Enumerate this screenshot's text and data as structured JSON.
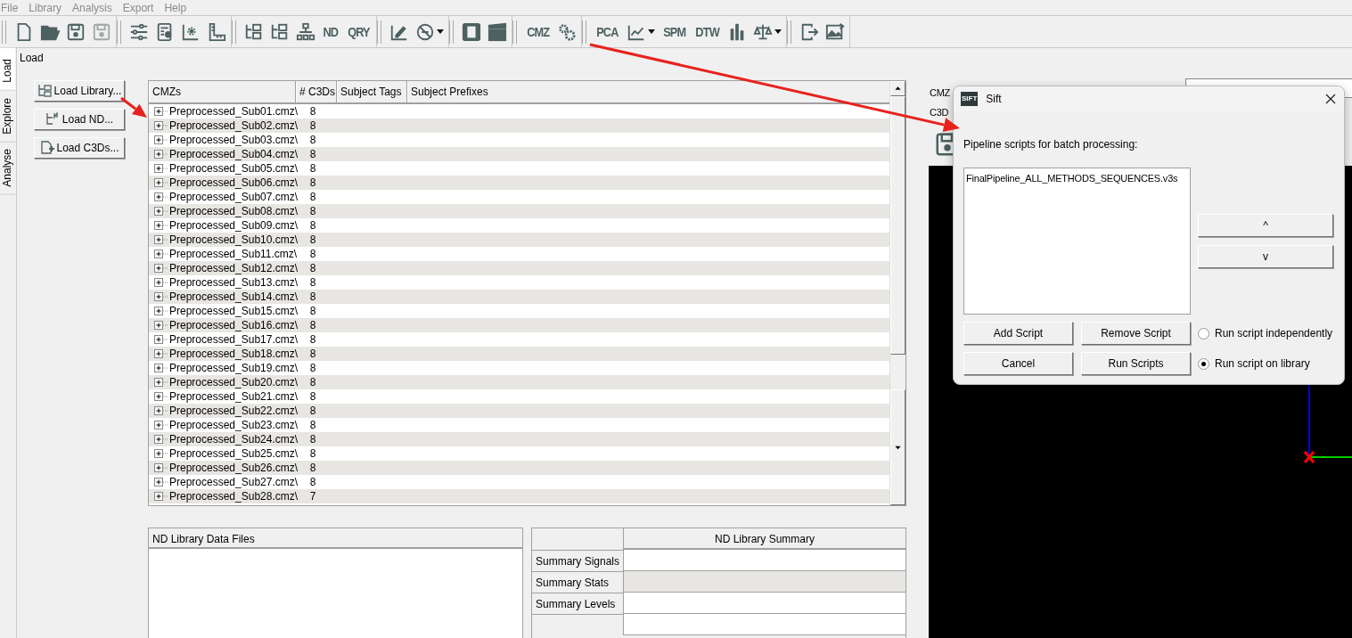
{
  "menu": [
    "File",
    "Library",
    "Analysis",
    "Export",
    "Help"
  ],
  "toolbar": {
    "groups": [
      {
        "items": [
          {
            "kind": "icon",
            "disabled": false
          },
          {
            "kind": "icon",
            "disabled": false
          },
          {
            "kind": "icon",
            "disabled": false
          },
          {
            "kind": "icon",
            "disabled": true
          }
        ]
      },
      {
        "items": [
          {
            "kind": "icon",
            "disabled": false
          },
          {
            "kind": "icon",
            "disabled": false
          },
          {
            "kind": "icon",
            "disabled": false
          },
          {
            "kind": "icon",
            "disabled": false
          }
        ]
      },
      {
        "items": [
          {
            "kind": "icon",
            "disabled": false
          },
          {
            "kind": "icon",
            "disabled": false
          },
          {
            "kind": "icon",
            "disabled": false
          },
          {
            "kind": "text",
            "label": "ND",
            "disabled": false
          },
          {
            "kind": "text",
            "label": "QRY",
            "disabled": false
          }
        ]
      },
      {
        "items": [
          {
            "kind": "icon",
            "disabled": false
          },
          {
            "kind": "icon",
            "disabled": false,
            "dropdown": true
          }
        ]
      },
      {
        "items": [
          {
            "kind": "icon",
            "disabled": false
          },
          {
            "kind": "icon",
            "disabled": false
          }
        ]
      },
      {
        "items": [
          {
            "kind": "text",
            "label": "CMZ",
            "disabled": false
          },
          {
            "kind": "icon",
            "disabled": false
          }
        ]
      },
      {
        "items": [
          {
            "kind": "text",
            "label": "PCA",
            "disabled": false
          },
          {
            "kind": "icon",
            "disabled": false,
            "dropdown": true
          },
          {
            "kind": "text",
            "label": "SPM",
            "disabled": false
          },
          {
            "kind": "text",
            "label": "DTW",
            "disabled": false
          },
          {
            "kind": "icon",
            "disabled": false
          },
          {
            "kind": "icon",
            "disabled": false,
            "dropdown": true
          }
        ]
      },
      {
        "items": [
          {
            "kind": "icon",
            "disabled": false
          },
          {
            "kind": "icon",
            "disabled": false
          }
        ]
      }
    ]
  },
  "side_tabs": [
    {
      "label": "Load",
      "selected": true
    },
    {
      "label": "Explore",
      "selected": false
    },
    {
      "label": "Analyse",
      "selected": false
    }
  ],
  "page_title": "Load",
  "load_buttons": [
    "Load Library...",
    "Load ND...",
    "Load C3Ds..."
  ],
  "cmz_table": {
    "columns": [
      "CMZs",
      "# C3Ds",
      "Subject Tags",
      "Subject Prefixes"
    ],
    "rows": [
      {
        "name": "Preprocessed_Sub01.cmz\\",
        "c3ds": "8"
      },
      {
        "name": "Preprocessed_Sub02.cmz\\",
        "c3ds": "8"
      },
      {
        "name": "Preprocessed_Sub03.cmz\\",
        "c3ds": "8"
      },
      {
        "name": "Preprocessed_Sub04.cmz\\",
        "c3ds": "8"
      },
      {
        "name": "Preprocessed_Sub05.cmz\\",
        "c3ds": "8"
      },
      {
        "name": "Preprocessed_Sub06.cmz\\",
        "c3ds": "8"
      },
      {
        "name": "Preprocessed_Sub07.cmz\\",
        "c3ds": "8"
      },
      {
        "name": "Preprocessed_Sub08.cmz\\",
        "c3ds": "8"
      },
      {
        "name": "Preprocessed_Sub09.cmz\\",
        "c3ds": "8"
      },
      {
        "name": "Preprocessed_Sub10.cmz\\",
        "c3ds": "8"
      },
      {
        "name": "Preprocessed_Sub11.cmz\\",
        "c3ds": "8"
      },
      {
        "name": "Preprocessed_Sub12.cmz\\",
        "c3ds": "8"
      },
      {
        "name": "Preprocessed_Sub13.cmz\\",
        "c3ds": "8"
      },
      {
        "name": "Preprocessed_Sub14.cmz\\",
        "c3ds": "8"
      },
      {
        "name": "Preprocessed_Sub15.cmz\\",
        "c3ds": "8"
      },
      {
        "name": "Preprocessed_Sub16.cmz\\",
        "c3ds": "8"
      },
      {
        "name": "Preprocessed_Sub17.cmz\\",
        "c3ds": "8"
      },
      {
        "name": "Preprocessed_Sub18.cmz\\",
        "c3ds": "8"
      },
      {
        "name": "Preprocessed_Sub19.cmz\\",
        "c3ds": "8"
      },
      {
        "name": "Preprocessed_Sub20.cmz\\",
        "c3ds": "8"
      },
      {
        "name": "Preprocessed_Sub21.cmz\\",
        "c3ds": "8"
      },
      {
        "name": "Preprocessed_Sub22.cmz\\",
        "c3ds": "8"
      },
      {
        "name": "Preprocessed_Sub23.cmz\\",
        "c3ds": "8"
      },
      {
        "name": "Preprocessed_Sub24.cmz\\",
        "c3ds": "8"
      },
      {
        "name": "Preprocessed_Sub25.cmz\\",
        "c3ds": "8"
      },
      {
        "name": "Preprocessed_Sub26.cmz\\",
        "c3ds": "8"
      },
      {
        "name": "Preprocessed_Sub27.cmz\\",
        "c3ds": "8"
      },
      {
        "name": "Preprocessed_Sub28.cmz\\",
        "c3ds": "7"
      }
    ]
  },
  "nd_files": {
    "title": "ND Library Data Files"
  },
  "nd_summary": {
    "title": "ND Library Summary",
    "rows": [
      {
        "label": "Summary Signals",
        "shaded": false
      },
      {
        "label": "Summary Stats",
        "shaded": true
      },
      {
        "label": "Summary Levels",
        "shaded": false
      }
    ]
  },
  "right_panel": {
    "labels": [
      "CMZ",
      "C3D"
    ]
  },
  "dialog": {
    "logo": "SIFT",
    "title": "Sift",
    "prompt": "Pipeline scripts for batch processing:",
    "scripts": [
      "FinalPipeline_ALL_METHODS_SEQUENCES.v3s"
    ],
    "move_buttons": [
      "^",
      "v"
    ],
    "buttons": [
      [
        "Add Script",
        "Remove Script"
      ],
      [
        "Cancel",
        "Run Scripts"
      ]
    ],
    "modes": [
      {
        "label": "Run script independently",
        "selected": false
      },
      {
        "label": "Run script on library",
        "selected": true
      }
    ]
  }
}
